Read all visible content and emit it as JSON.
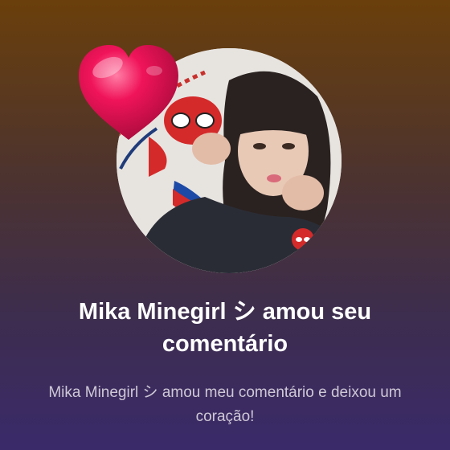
{
  "notification": {
    "avatar_icon": "profile-photo",
    "reaction_icon": "heart-icon",
    "title": "Mika Minegirl シ amou seu comentário",
    "message": "Mika Minegirl シ amou meu comentário e deixou um coração!"
  },
  "colors": {
    "background_top": "#6a3f0b",
    "background_bottom": "#3a2a6a",
    "heart": "#f0145a",
    "title_text": "#ffffff",
    "message_text": "#cfc8d6"
  }
}
